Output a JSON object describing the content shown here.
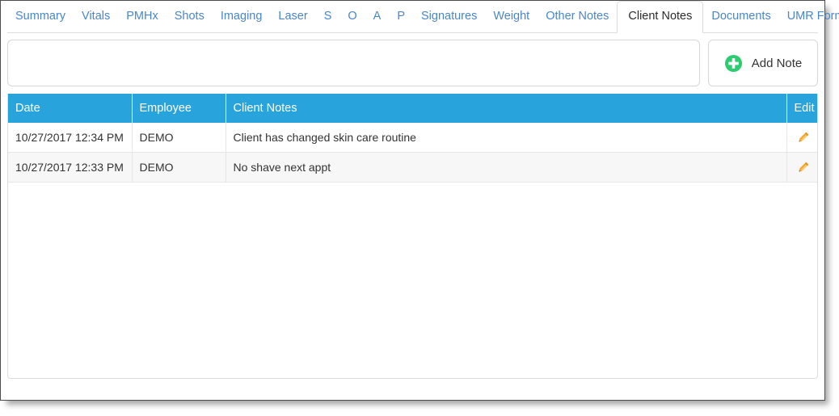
{
  "tabs": [
    {
      "label": "Summary",
      "active": false
    },
    {
      "label": "Vitals",
      "active": false
    },
    {
      "label": "PMHx",
      "active": false
    },
    {
      "label": "Shots",
      "active": false
    },
    {
      "label": "Imaging",
      "active": false
    },
    {
      "label": "Laser",
      "active": false
    },
    {
      "label": "S",
      "active": false
    },
    {
      "label": "O",
      "active": false
    },
    {
      "label": "A",
      "active": false
    },
    {
      "label": "P",
      "active": false
    },
    {
      "label": "Signatures",
      "active": false
    },
    {
      "label": "Weight",
      "active": false
    },
    {
      "label": "Other Notes",
      "active": false
    },
    {
      "label": "Client Notes",
      "active": true
    },
    {
      "label": "Documents",
      "active": false
    },
    {
      "label": "UMR Forms",
      "active": false
    }
  ],
  "toolbar": {
    "filter_value": "",
    "filter_placeholder": "",
    "add_note_label": "Add Note",
    "add_note_icon": "plus-circle-icon"
  },
  "grid": {
    "columns": [
      {
        "key": "date",
        "label": "Date"
      },
      {
        "key": "emp",
        "label": "Employee"
      },
      {
        "key": "notes",
        "label": "Client Notes"
      },
      {
        "key": "edit",
        "label": "Edit"
      }
    ],
    "rows": [
      {
        "date": "10/27/2017 12:34 PM",
        "emp": "DEMO",
        "notes": "Client has changed skin care routine",
        "edit_icon": "pencil-icon"
      },
      {
        "date": "10/27/2017 12:33 PM",
        "emp": "DEMO",
        "notes": "No shave next appt",
        "edit_icon": "pencil-icon"
      }
    ]
  },
  "colors": {
    "header_blue": "#29a3db",
    "tab_link": "#4a86c8",
    "add_icon_green": "#2ecc71",
    "pencil_orange": "#f5a623",
    "row_alt": "#f7f7f7"
  }
}
